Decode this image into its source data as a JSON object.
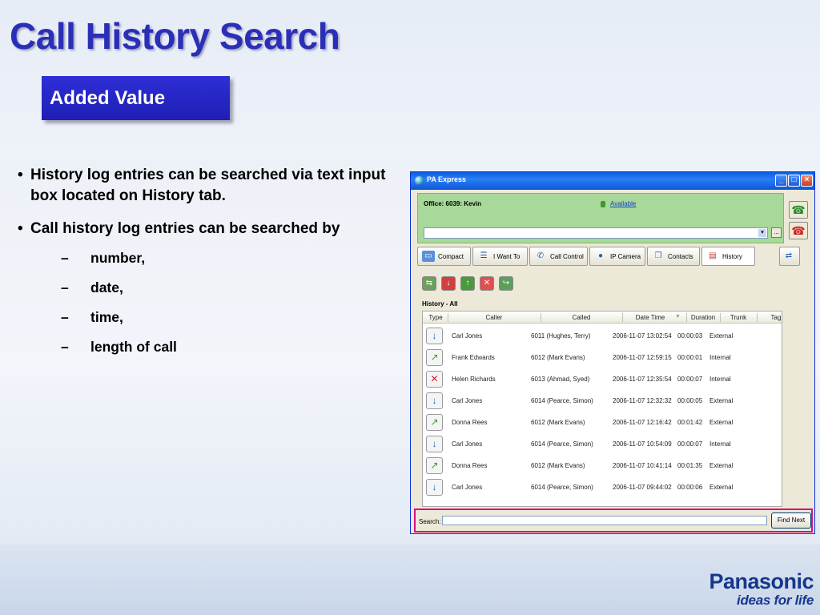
{
  "slide": {
    "title": "Call History Search",
    "subtitle": "Added Value",
    "bullets": [
      "History log entries can be searched via text input box located on History tab.",
      "Call history log entries can be searched by"
    ],
    "sub_bullets": [
      "number,",
      "date,",
      "time,",
      "length of call"
    ],
    "logo_brand": "Panasonic",
    "logo_tagline": "ideas for life"
  },
  "window": {
    "title": "PA Express",
    "controls": {
      "minimize": "_",
      "maximize": "□",
      "close": "×"
    },
    "status": {
      "office": "Office: 6039: Kevin",
      "presence": "Available",
      "dial_dropdown": "▾",
      "dial_more": "..."
    },
    "tabs": [
      {
        "label": "Compact",
        "icon": "compact-icon"
      },
      {
        "label": "I Want To",
        "icon": "list-icon"
      },
      {
        "label": "Call Control",
        "icon": "phone-icon"
      },
      {
        "label": "IP Camera",
        "icon": "camera-icon"
      },
      {
        "label": "Contacts",
        "icon": "contacts-icon"
      },
      {
        "label": "History",
        "icon": "history-icon"
      }
    ],
    "history_title": "History - All",
    "columns": [
      "Type",
      "Caller",
      "Called",
      "Date Time",
      "Duration",
      "Trunk",
      "Tag"
    ],
    "rows": [
      {
        "type": "incoming",
        "caller": "Carl Jones",
        "called": "6011  (Hughes, Terry)",
        "datetime": "2006-11-07 13:02:54",
        "duration": "00:00:03",
        "trunk": "External"
      },
      {
        "type": "outgoing",
        "caller": "Frank Edwards",
        "called": "6012  (Mark Evans)",
        "datetime": "2006-11-07 12:59:15",
        "duration": "00:00:01",
        "trunk": "Internal"
      },
      {
        "type": "missed",
        "caller": "Helen Richards",
        "called": "6013  (Ahmad, Syed)",
        "datetime": "2006-11-07 12:35:54",
        "duration": "00:00:07",
        "trunk": "Internal"
      },
      {
        "type": "incoming",
        "caller": "Carl Jones",
        "called": "6014  (Pearce, Simon)",
        "datetime": "2006-11-07 12:32:32",
        "duration": "00:00:05",
        "trunk": "External"
      },
      {
        "type": "outgoing",
        "caller": "Donna Rees",
        "called": "6012  (Mark Evans)",
        "datetime": "2006-11-07 12:16:42",
        "duration": "00:01:42",
        "trunk": "External"
      },
      {
        "type": "incoming",
        "caller": "Carl Jones",
        "called": "6014  (Pearce, Simon)",
        "datetime": "2006-11-07 10:54:09",
        "duration": "00:00:07",
        "trunk": "Internal"
      },
      {
        "type": "outgoing",
        "caller": "Donna Rees",
        "called": "6012  (Mark Evans)",
        "datetime": "2006-11-07 10:41:14",
        "duration": "00:01:35",
        "trunk": "External"
      },
      {
        "type": "incoming",
        "caller": "Carl Jones",
        "called": "6014  (Pearce, Simon)",
        "datetime": "2006-11-07 09:44:02",
        "duration": "00:00:06",
        "trunk": "External"
      }
    ],
    "search": {
      "label": "Search:",
      "value": "",
      "find_button": "Find Next"
    },
    "colors": {
      "accent": "#2b2fb8",
      "status_green": "#a8d89a",
      "search_highlight": "#d4137f"
    }
  }
}
